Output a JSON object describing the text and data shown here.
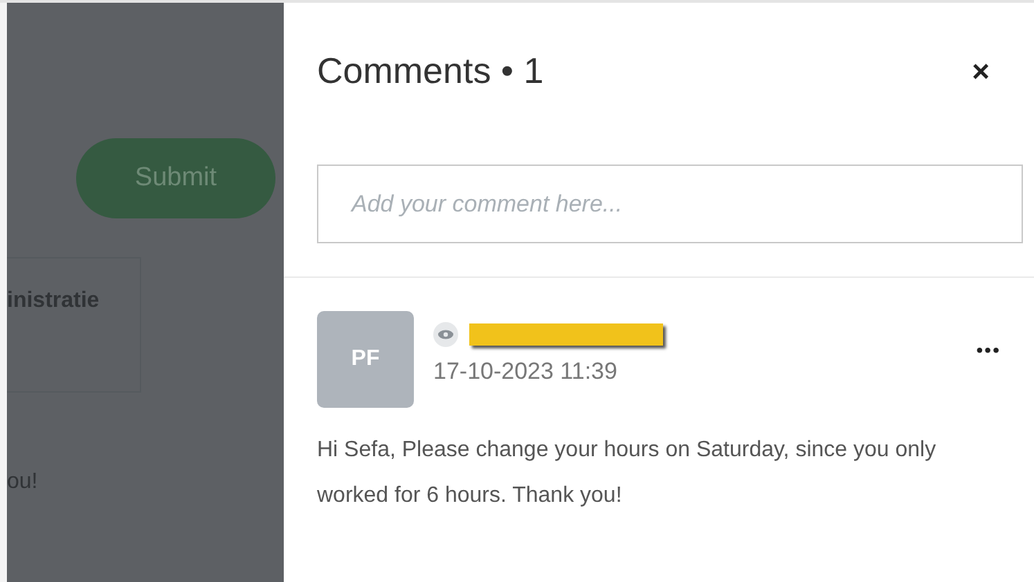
{
  "background": {
    "submit_button": "Submit",
    "card_text": "inistratie",
    "message_fragment": "ou!"
  },
  "panel": {
    "title": "Comments • 1",
    "close": "×",
    "comment_input": {
      "placeholder": "Add your comment here..."
    },
    "comments": [
      {
        "initials": "PF",
        "author_redacted": true,
        "timestamp": "17-10-2023 11:39",
        "menu": "•••",
        "text": "Hi Sefa, Please change your hours on Saturday, since you only worked for 6 hours. Thank you!"
      }
    ]
  }
}
